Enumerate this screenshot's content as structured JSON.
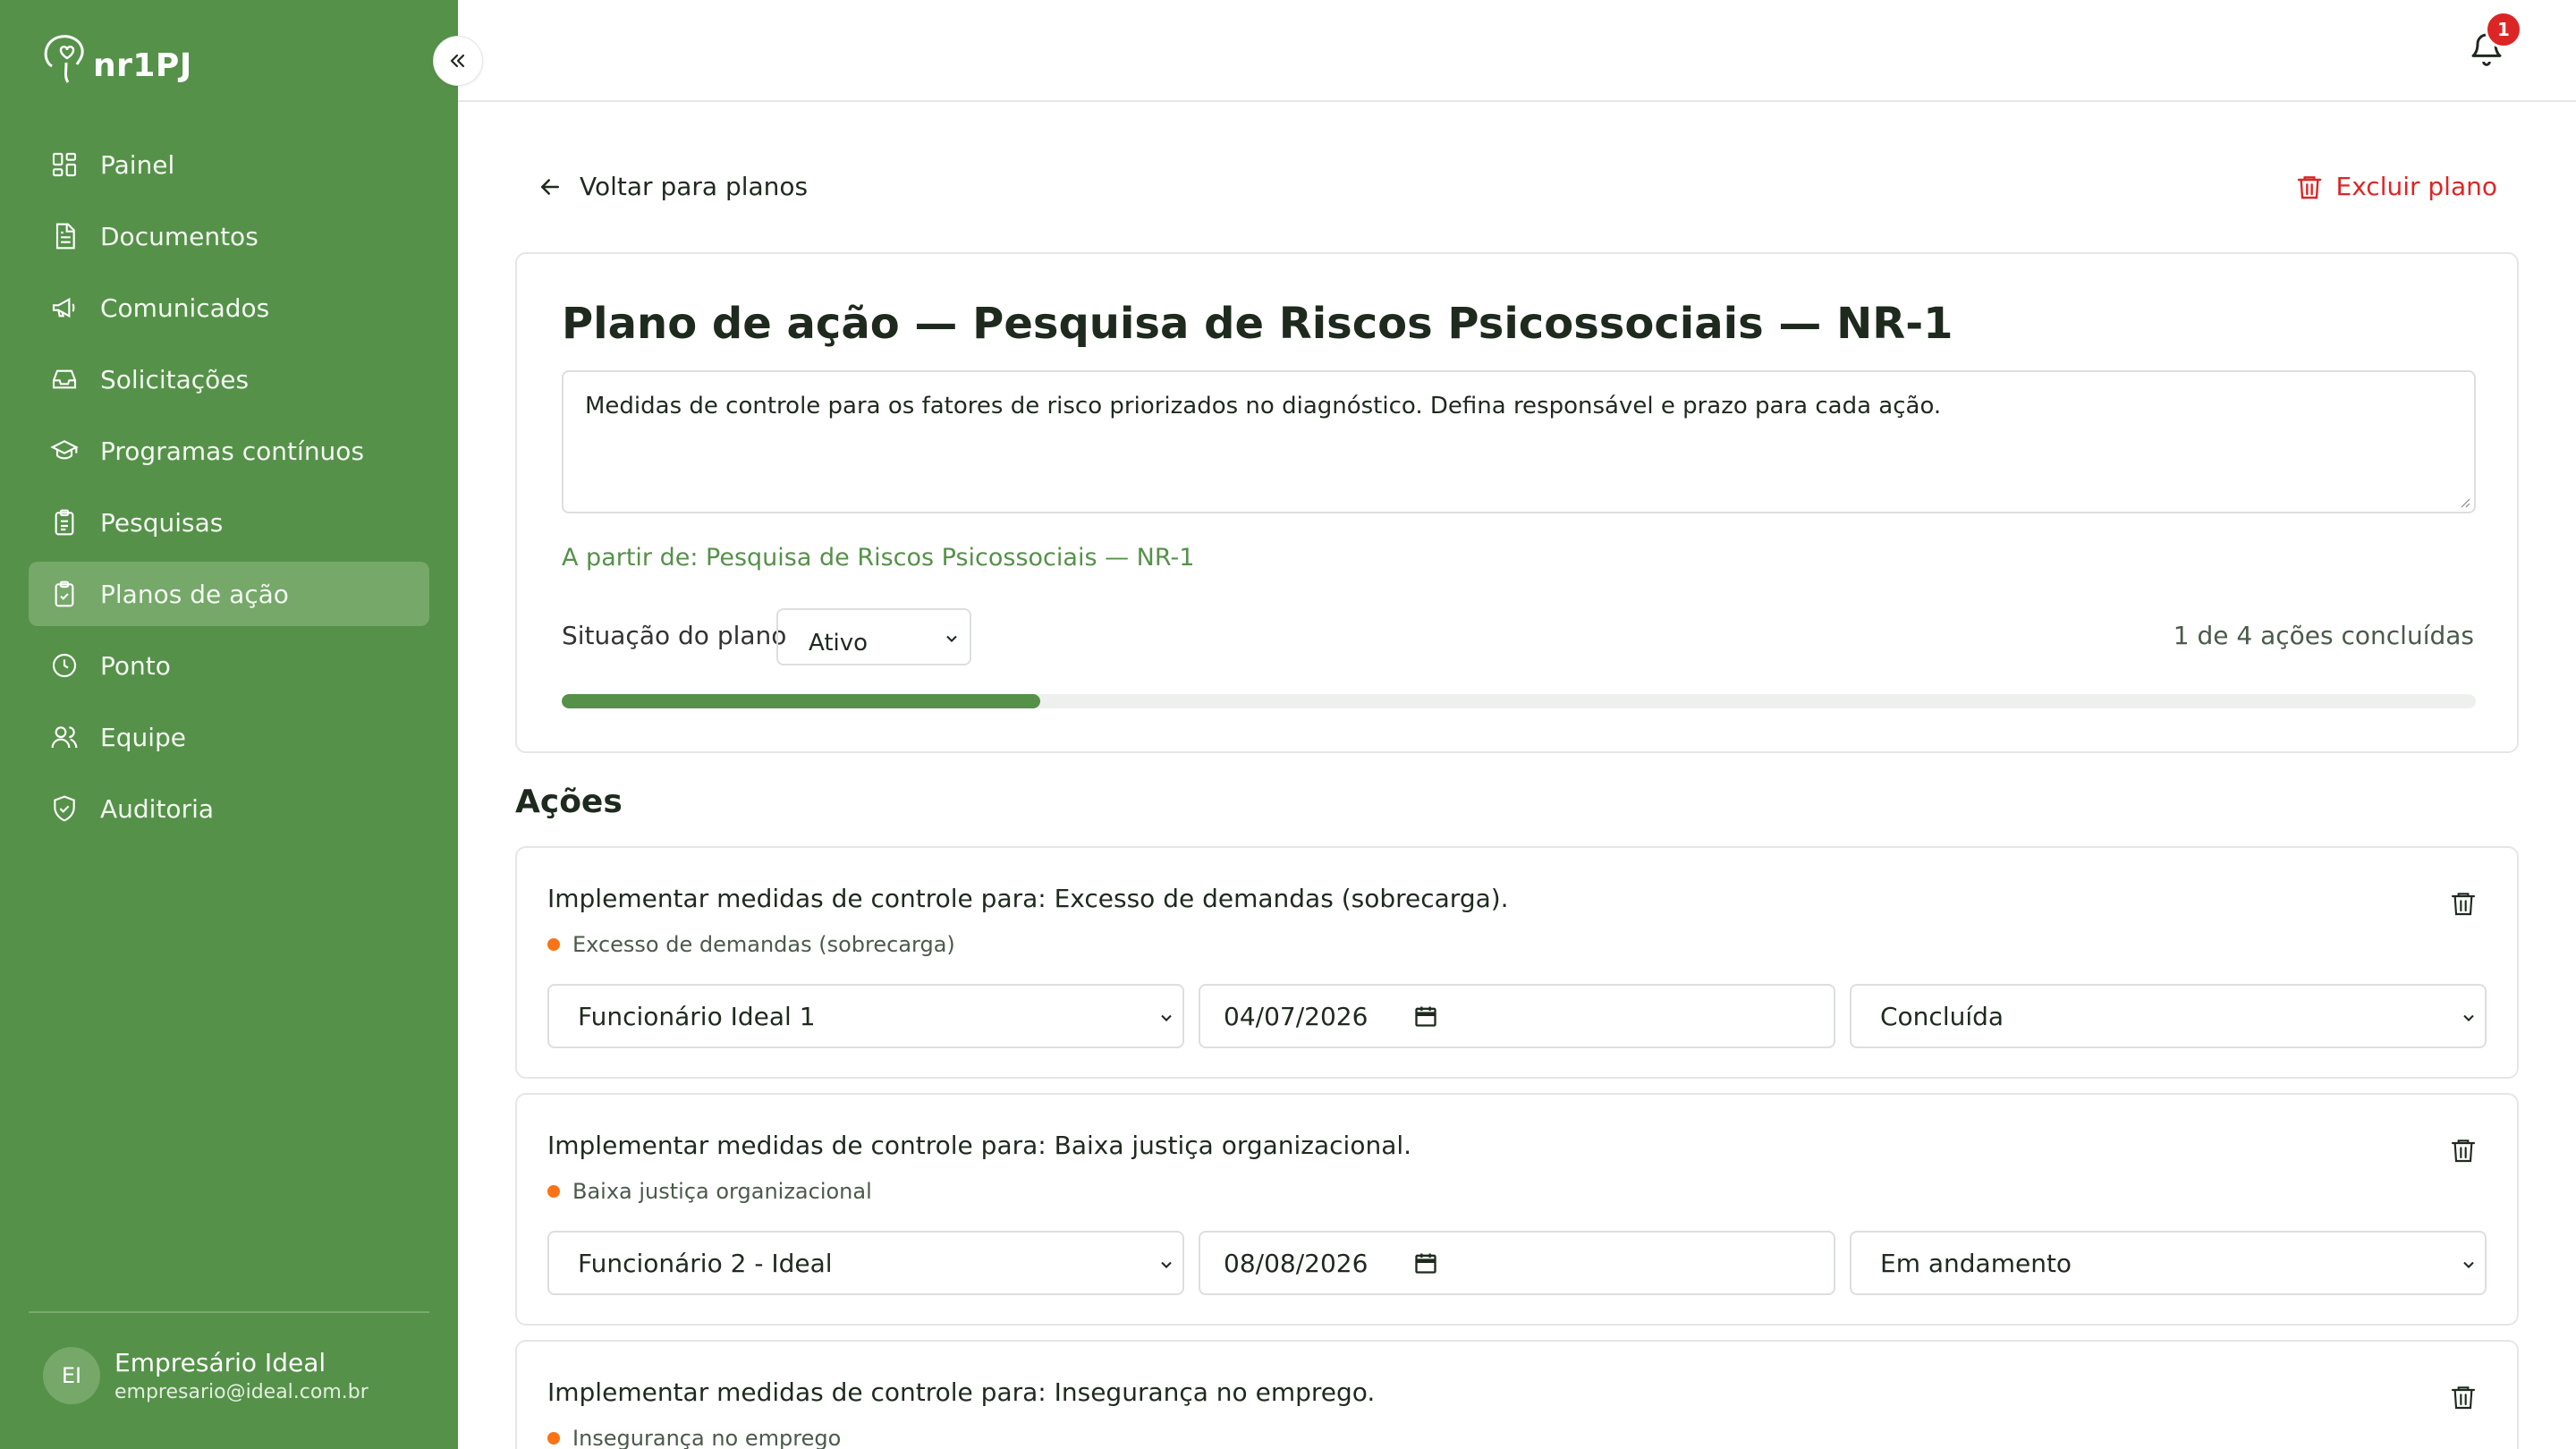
{
  "app": {
    "brand": "nr1PJ"
  },
  "sidebar": {
    "items": [
      {
        "label": "Painel",
        "icon": "dashboard-icon"
      },
      {
        "label": "Documentos",
        "icon": "document-icon"
      },
      {
        "label": "Comunicados",
        "icon": "megaphone-icon"
      },
      {
        "label": "Solicitações",
        "icon": "inbox-icon"
      },
      {
        "label": "Programas contínuos",
        "icon": "graduation-cap-icon"
      },
      {
        "label": "Pesquisas",
        "icon": "clipboard-icon"
      },
      {
        "label": "Planos de ação",
        "icon": "clipboard-check-icon",
        "active": true
      },
      {
        "label": "Ponto",
        "icon": "clock-icon"
      },
      {
        "label": "Equipe",
        "icon": "users-icon"
      },
      {
        "label": "Auditoria",
        "icon": "shield-check-icon"
      }
    ],
    "user": {
      "initials": "EI",
      "name": "Empresário Ideal",
      "email": "empresario@ideal.com.br"
    }
  },
  "topbar": {
    "notification_count": "1"
  },
  "header": {
    "back_label": "Voltar para planos",
    "delete_label": "Excluir plano"
  },
  "plan": {
    "title": "Plano de ação — Pesquisa de Riscos Psicossociais — NR-1",
    "description": "Medidas de controle para os fatores de risco priorizados no diagnóstico. Defina responsável e prazo para cada ação.",
    "source": "A partir de: Pesquisa de Riscos Psicossociais — NR-1",
    "status_label": "Situação do plano",
    "status_value": "Ativo",
    "progress_text": "1 de 4 ações concluídas",
    "progress_fraction": 0.25
  },
  "actions_section": {
    "title": "Ações",
    "items": [
      {
        "title": "Implementar medidas de controle para: Excesso de demandas (sobrecarga).",
        "risk": "Excesso de demandas (sobrecarga)",
        "responsible": "Funcionário Ideal 1",
        "due_date": "04/07/2026",
        "status": "Concluída"
      },
      {
        "title": "Implementar medidas de controle para: Baixa justiça organizacional.",
        "risk": "Baixa justiça organizacional",
        "responsible": "Funcionário 2 - Ideal",
        "due_date": "08/08/2026",
        "status": "Em andamento"
      },
      {
        "title": "Implementar medidas de controle para: Insegurança no emprego.",
        "risk": "Insegurança no emprego"
      }
    ]
  },
  "colors": {
    "sidebar_bg": "#559149",
    "active_item": "#75a869",
    "danger": "#dc2626",
    "risk_dot": "#f97316"
  }
}
